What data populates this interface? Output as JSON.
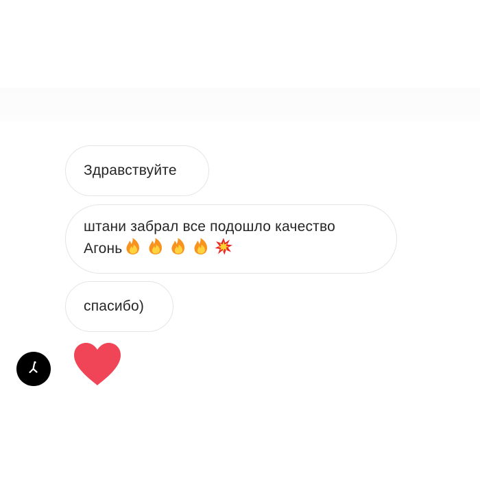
{
  "thread": {
    "messages": [
      {
        "text": "Здравствуйте"
      },
      {
        "line1": "штани забрал все подошло качество",
        "line2": "Агонь",
        "emojis": [
          "fire-icon",
          "fire-icon",
          "fire-icon",
          "fire-icon",
          "collision-icon"
        ]
      },
      {
        "text": "спасибо)"
      }
    ],
    "reaction": {
      "icon": "heart-icon",
      "color": "#ef4557"
    },
    "avatar": {
      "icon": "avatar-icon",
      "color": "#000000"
    }
  },
  "colors": {
    "bubble_border": "#e4e4e4",
    "text": "#262626",
    "background": "#ffffff"
  }
}
